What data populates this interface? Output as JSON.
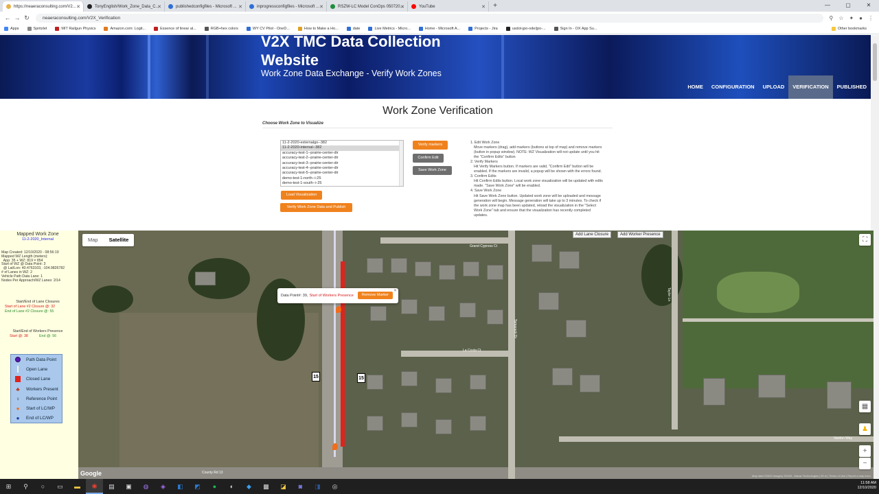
{
  "browser": {
    "tabs": [
      {
        "title": "https://neaeraconsulting.com/V2...",
        "color": "#e8b04a"
      },
      {
        "title": "TonyEnglish/Work_Zone_Data_C...",
        "color": "#222222"
      },
      {
        "title": "publishedconfigfiles - Microsoft ...",
        "color": "#2f6fd6"
      },
      {
        "title": "inprogressconfigfiles - Microsoft ...",
        "color": "#2f6fd6"
      },
      {
        "title": "RSZW-LC Model ConOps 050720...",
        "color": "#1e8e3e"
      },
      {
        "title": "YouTube",
        "color": "#ff0000"
      }
    ],
    "url": "neaeraconsulting.com/V2X_Verification",
    "bookmarks": [
      "Apps",
      "Spritzlet",
      "MIT Railgun Physics",
      "Amazon.com: Logit...",
      "Essence of linear al...",
      "RGB+hex colors",
      "WY CV Pilot - OneD...",
      "How to Make a Ho...",
      "date",
      "Live Metrics - Micro...",
      "Home - Microsoft A...",
      "Projects - Jira",
      "usdot-jpo-ode/jpo-...",
      "Sign In - OX App Su..."
    ],
    "other_bookmarks": "Other bookmarks"
  },
  "site": {
    "title": "V2X TMC Data Collection Website",
    "subtitle": "Work Zone Data Exchange - Verify Work Zones",
    "nav": [
      {
        "label": "HOME",
        "active": false
      },
      {
        "label": "CONFIGURATION",
        "active": false
      },
      {
        "label": "UPLOAD",
        "active": false
      },
      {
        "label": "VERIFICATION",
        "active": true
      },
      {
        "label": "PUBLISHED",
        "active": false
      }
    ]
  },
  "page": {
    "title": "Work Zone Verification",
    "choose_label": "Choose Work Zone to Visualize",
    "work_zones": [
      "11-2-2020-externalgo--382",
      "11-2-2020-internal--382",
      "accuracy-test-1--prairie-center-dir",
      "accuracy-test-2--prairie-center-dir",
      "accuracy-test-3--prairie-center-dir",
      "accuracy-test-4--prairie-center-dir",
      "accuracy-test-5--prairie-center-dir",
      "demo-test-1-north--i-25",
      "demo-test-1-south--i-25"
    ],
    "selected_index": 1,
    "buttons": {
      "load": "Load Visualization",
      "verify_publish": "Verify Work Zone Data and Publish",
      "verify_markers": "Verify markers",
      "confirm_edit": "Confirm Edit",
      "save_work_zone": "Save Work Zone"
    },
    "instructions": [
      {
        "head": "1. Edit Work Zone",
        "body": "Move markers (drag), add markers (buttons at top of map) and remove markers (button in popup window). NOTE: WZ Visualization will not update until you hit the \"Confirm Edits\" button"
      },
      {
        "head": "2. Verify Markers",
        "body": "Hit Verify Markers button. If markers are valid, \"Confirm Edit\" button will be enabled. If the markers are invalid, a popup will be shown with the errors found."
      },
      {
        "head": "3. Confirm Edits",
        "body": "Hit Confirm Edits button. Local work zone visualization will be updated with edits made. \"Save Work Zone\" will be enabled."
      },
      {
        "head": "4. Save Work Zone",
        "body": "Hit Save Work Zone button. Updated work zone will be uploaded and message generation will begin. Message generation will take up to 3 minutes. To check if the work zone map has been updated, reload the visualization in the \"Select Work Zone\" tab and ensure that the visualization has recently completed updates."
      }
    ]
  },
  "info_panel": {
    "title": "Mapped Work Zone",
    "work_zone": "11-2-2020_Internal",
    "stats": [
      "Map Created: 12/10/2020 - 08:56:19",
      "Mapped WZ Length (meters):",
      "  App: 35 + WZ: 819 = 854",
      "Start of WZ @ Data Point: 3",
      "  @ Lat/Lon: 40.4763103, -104.9826782",
      "# of Lanes in WZ: 2",
      "Vehicle Path Data Lane: 1",
      "Nodes Per Approach/WZ Lanes: 2/14"
    ],
    "lane_closures_title": "Start/End of Lane Closures",
    "lane_closure_start": "Start of Lane #2 Closure @: 32",
    "lane_closure_end": "End of Lane #2 Closure @: 55",
    "workers_title": "Start/End of Workers Presence",
    "workers_start": "Start @: 38",
    "workers_end": "End @: 56",
    "legend": [
      {
        "label": "Path Data Point",
        "icon": "path-point-icon"
      },
      {
        "label": "Open Lane",
        "icon": "open-lane-icon"
      },
      {
        "label": "Closed Lane",
        "icon": "closed-lane-icon"
      },
      {
        "label": "Workers Present",
        "icon": "worker-icon"
      },
      {
        "label": "Reference Point",
        "icon": "reference-icon"
      },
      {
        "label": "Start of LC/WP",
        "icon": "start-marker-icon"
      },
      {
        "label": "End of LC/WP",
        "icon": "end-marker-icon"
      }
    ]
  },
  "map": {
    "type_map": "Map",
    "type_satellite": "Satellite",
    "add_lane_closure": "Add Lane Closure",
    "add_worker_presence": "Add Worker Presence",
    "popup_point": "Data Point#: 39,",
    "popup_type": "Start of Workers Presence",
    "popup_remove": "Remove Marker",
    "streets": {
      "grand_cypress": "Grand Cypress Ct",
      "la_costa": "La Costa Ct",
      "tamarack_dr": "Tamarack Dr",
      "taylor_ln": "Taylor Ln",
      "vardon_way": "Vardon Way",
      "cr": "County Rd 13"
    },
    "route": "15",
    "google": "Google",
    "attribution": "Map data ©2020 Imagery ©2020 , Maxar Technologies | 50 m | Terms of Use | Report a map error"
  },
  "taskbar": {
    "time": "11:58 AM",
    "date": "12/10/2020"
  }
}
